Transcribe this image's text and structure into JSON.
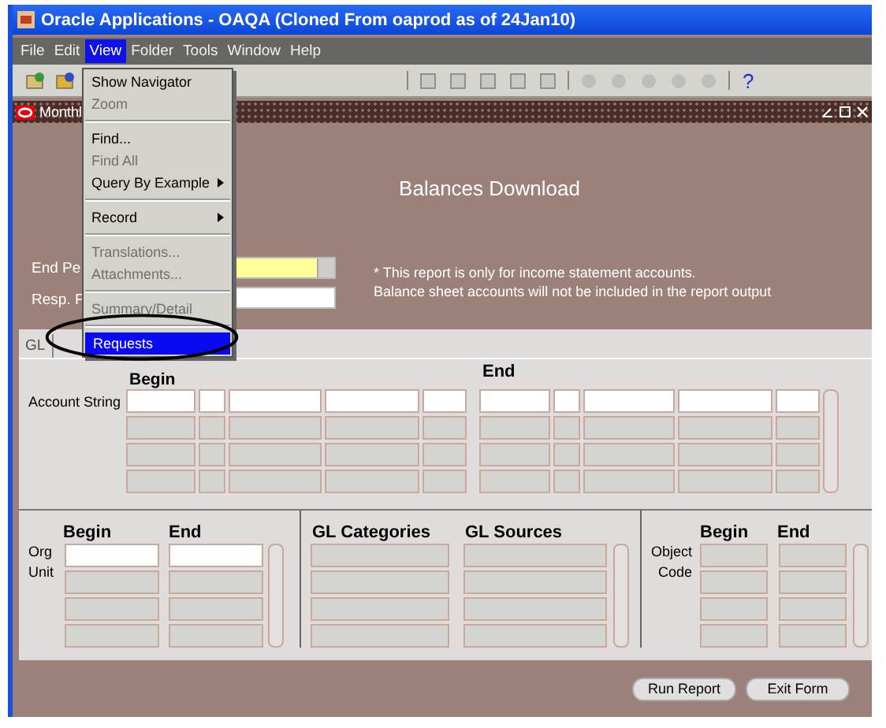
{
  "window": {
    "title": "Oracle Applications - OAQA (Cloned From oaprod as of 24Jan10)"
  },
  "menubar": [
    {
      "label": "File",
      "selected": false
    },
    {
      "label": "Edit",
      "selected": false
    },
    {
      "label": "View",
      "selected": true
    },
    {
      "label": "Folder",
      "selected": false
    },
    {
      "label": "Tools",
      "selected": false
    },
    {
      "label": "Window",
      "selected": false
    },
    {
      "label": "Help",
      "selected": false
    }
  ],
  "view_menu": [
    {
      "kind": "item",
      "label": "Show Navigator",
      "disabled": false,
      "has_submenu": false,
      "selected": false
    },
    {
      "kind": "item",
      "label": "Zoom",
      "disabled": true,
      "has_submenu": false,
      "selected": false
    },
    {
      "kind": "separator"
    },
    {
      "kind": "item",
      "label": "Find...",
      "disabled": false,
      "has_submenu": false,
      "selected": false
    },
    {
      "kind": "item",
      "label": "Find All",
      "disabled": true,
      "has_submenu": false,
      "selected": false
    },
    {
      "kind": "item",
      "label": "Query By Example",
      "disabled": false,
      "has_submenu": true,
      "selected": false
    },
    {
      "kind": "separator"
    },
    {
      "kind": "item",
      "label": "Record",
      "disabled": false,
      "has_submenu": true,
      "selected": false
    },
    {
      "kind": "separator"
    },
    {
      "kind": "item",
      "label": "Translations...",
      "disabled": true,
      "has_submenu": false,
      "selected": false
    },
    {
      "kind": "item",
      "label": "Attachments...",
      "disabled": true,
      "has_submenu": false,
      "selected": false
    },
    {
      "kind": "separator"
    },
    {
      "kind": "item",
      "label": "Summary/Detail",
      "disabled": true,
      "has_submenu": false,
      "selected": false
    },
    {
      "kind": "separator"
    },
    {
      "kind": "item",
      "label": "Requests",
      "disabled": false,
      "has_submenu": false,
      "selected": true
    }
  ],
  "toolbar": {
    "help": "?"
  },
  "form_window": {
    "title": "Monthl"
  },
  "form": {
    "heading": "Balances Download",
    "fields": [
      {
        "label": "End Pe",
        "kind": "dropdown"
      },
      {
        "label": "Resp. F",
        "kind": "text"
      }
    ],
    "note": [
      "* This report is only for income statement accounts.",
      "Balance sheet accounts will not be included in the report output"
    ]
  },
  "tabs": [
    {
      "label": "GL"
    }
  ],
  "account": {
    "label": "Account String",
    "begin": "Begin",
    "end": "End"
  },
  "org": {
    "label": [
      "Org",
      "Unit"
    ],
    "begin": "Begin",
    "end": "End"
  },
  "gl": {
    "categories": "GL Categories",
    "sources": "GL Sources"
  },
  "object": {
    "label": [
      "Object",
      "Code"
    ],
    "begin": "Begin",
    "end": "End"
  },
  "buttons": [
    "Run Report",
    "Exit Form"
  ]
}
